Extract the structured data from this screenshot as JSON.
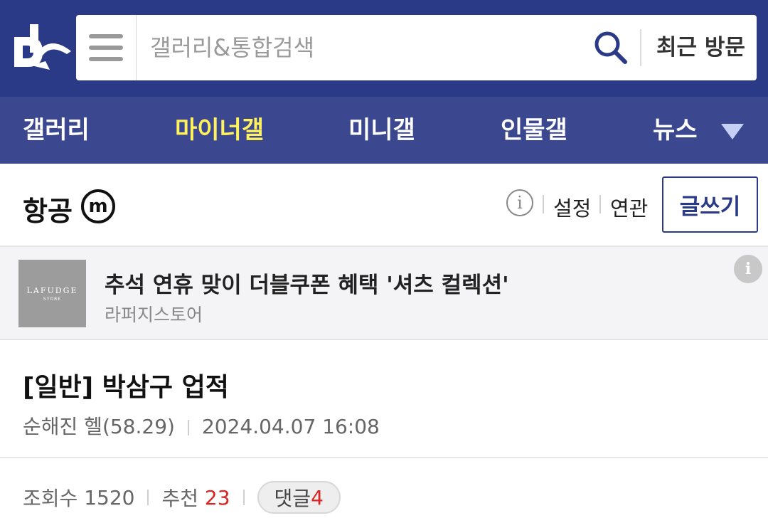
{
  "header": {
    "logo_icon": "dc-logo-icon",
    "menu_icon": "hamburger-icon",
    "search": {
      "placeholder": "갤러리&통합검색",
      "value": ""
    },
    "search_icon": "search-icon",
    "recent_label": "최근 방문"
  },
  "nav": {
    "items": [
      {
        "label": "갤러리",
        "active": false
      },
      {
        "label": "마이너갤",
        "active": true
      },
      {
        "label": "미니갤",
        "active": false
      },
      {
        "label": "인물갤",
        "active": false
      },
      {
        "label": "뉴스",
        "active": false
      }
    ],
    "expand_icon": "chevron-down-icon"
  },
  "gallery": {
    "title": "항공",
    "badge": "m",
    "info_icon": "info-icon",
    "settings_label": "설정",
    "related_label": "연관",
    "write_label": "글쓰기"
  },
  "ad": {
    "brand": "LAFUDGE",
    "brand_sub": "STORE",
    "title": "추석 연휴 맞이 더블쿠폰 혜택 '셔츠 컬렉션'",
    "advertiser": "라퍼지스토어",
    "info_icon": "info-icon"
  },
  "post": {
    "title": "[일반] 박삼구 업적",
    "author": "순해진 헬(58.29)",
    "date": "2024.04.07 16:08",
    "views_label": "조회수",
    "views": "1520",
    "recommend_label": "추천",
    "recommend": "23",
    "comment_label": "댓글",
    "comment_count": "4"
  },
  "colors": {
    "header_bg": "#2b3a87",
    "nav_bg": "#3b4890",
    "nav_active": "#fff25b",
    "accent_red": "#dd2222"
  }
}
